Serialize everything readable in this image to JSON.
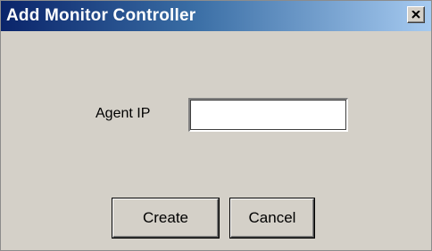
{
  "window": {
    "title": "Add Monitor Controller",
    "close_icon": "close-icon"
  },
  "form": {
    "agent_ip_label": "Agent IP",
    "agent_ip_value": "",
    "agent_ip_placeholder": ""
  },
  "buttons": {
    "create_label": "Create",
    "cancel_label": "Cancel"
  },
  "colors": {
    "titlebar_start": "#0a246a",
    "titlebar_end": "#a6caf0",
    "dialog_background": "#d4d0c8"
  }
}
